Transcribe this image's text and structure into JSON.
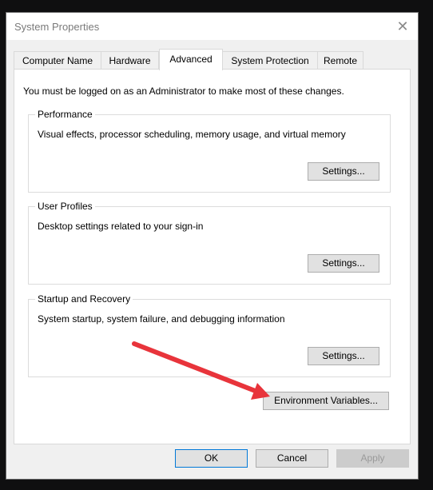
{
  "window": {
    "title": "System Properties",
    "close_glyph": "✕"
  },
  "tabs": [
    {
      "label": "Computer Name",
      "active": false
    },
    {
      "label": "Hardware",
      "active": false
    },
    {
      "label": "Advanced",
      "active": true
    },
    {
      "label": "System Protection",
      "active": false
    },
    {
      "label": "Remote",
      "active": false
    }
  ],
  "advanced": {
    "note": "You must be logged on as an Administrator to make most of these changes.",
    "performance": {
      "legend": "Performance",
      "description": "Visual effects, processor scheduling, memory usage, and virtual memory",
      "button": "Settings..."
    },
    "user_profiles": {
      "legend": "User Profiles",
      "description": "Desktop settings related to your sign-in",
      "button": "Settings..."
    },
    "startup_recovery": {
      "legend": "Startup and Recovery",
      "description": "System startup, system failure, and debugging information",
      "button": "Settings..."
    },
    "environment_button": "Environment Variables..."
  },
  "footer": {
    "ok": "OK",
    "cancel": "Cancel",
    "apply": "Apply"
  },
  "annotation": {
    "icon": "arrow-icon",
    "color": "#e8343b"
  }
}
